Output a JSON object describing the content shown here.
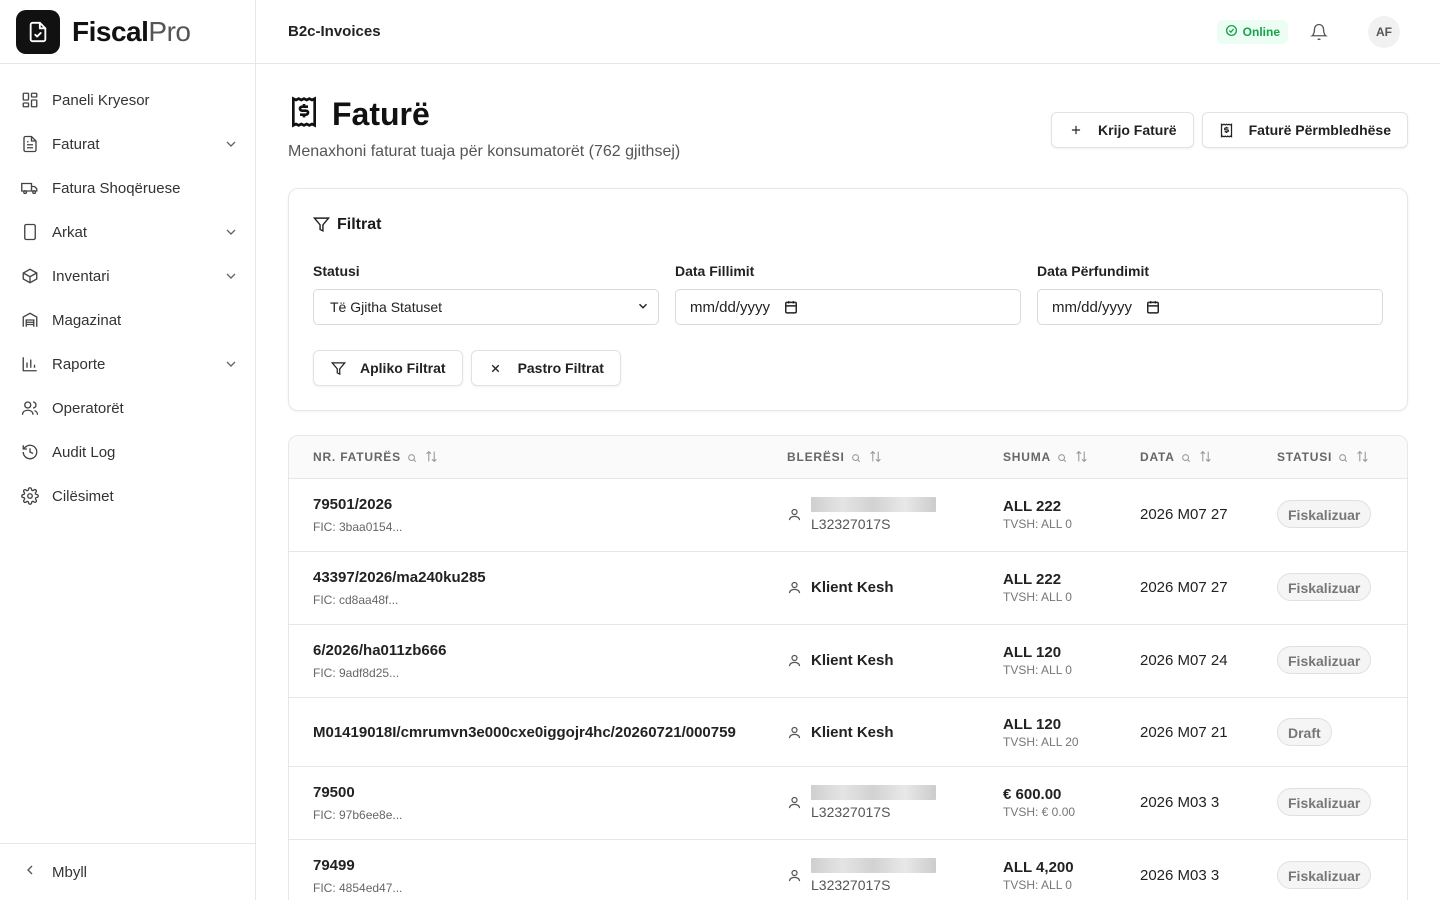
{
  "brand": {
    "name_bold": "Fiscal",
    "name_light": "Pro"
  },
  "sidebar": {
    "items": [
      {
        "label": "Paneli Kryesor",
        "icon": "dashboard-icon",
        "has_children": false
      },
      {
        "label": "Faturat",
        "icon": "invoice-icon",
        "has_children": true
      },
      {
        "label": "Fatura Shoqëruese",
        "icon": "truck-icon",
        "has_children": false
      },
      {
        "label": "Arkat",
        "icon": "tablet-icon",
        "has_children": true
      },
      {
        "label": "Inventari",
        "icon": "package-icon",
        "has_children": true
      },
      {
        "label": "Magazinat",
        "icon": "warehouse-icon",
        "has_children": false
      },
      {
        "label": "Raporte",
        "icon": "bar-chart-icon",
        "has_children": true
      },
      {
        "label": "Operatorët",
        "icon": "users-icon",
        "has_children": false
      },
      {
        "label": "Audit Log",
        "icon": "history-icon",
        "has_children": false
      },
      {
        "label": "Cilësimet",
        "icon": "gear-icon",
        "has_children": false
      }
    ],
    "collapse_label": "Mbyll"
  },
  "topbar": {
    "title": "B2c-Invoices",
    "status": "Online",
    "avatar": "AF"
  },
  "page": {
    "title": "Faturë",
    "subtitle": "Menaxhoni faturat tuaja për konsumatorët (762 gjithsej)",
    "create_label": "Krijo Faturë",
    "summary_label": "Faturë Përmbledhëse"
  },
  "filters": {
    "title": "Filtrat",
    "status_label": "Statusi",
    "status_value": "Të Gjitha Statuset",
    "start_label": "Data Fillimit",
    "start_placeholder": "mm/dd/yyyy",
    "end_label": "Data Përfundimit",
    "end_placeholder": "mm/dd/yyyy",
    "apply_label": "Apliko Filtrat",
    "clear_label": "Pastro Filtrat"
  },
  "table": {
    "columns": [
      "NR. FATURËS",
      "BLERËSI",
      "SHUMA",
      "DATA",
      "STATUSI"
    ],
    "rows": [
      {
        "nr": "79501/2026",
        "fic": "FIC: 3baa0154...",
        "buyer": "",
        "nipt": "L32327017S",
        "amount": "ALL 222",
        "vat": "TVSH: ALL 0",
        "date": "2026 M07 27",
        "status": "Fiskalizuar"
      },
      {
        "nr": "43397/2026/ma240ku285",
        "fic": "FIC: cd8aa48f...",
        "buyer": "Klient Kesh",
        "nipt": "",
        "amount": "ALL 222",
        "vat": "TVSH: ALL 0",
        "date": "2026 M07 27",
        "status": "Fiskalizuar"
      },
      {
        "nr": "6/2026/ha011zb666",
        "fic": "FIC: 9adf8d25...",
        "buyer": "Klient Kesh",
        "nipt": "",
        "amount": "ALL 120",
        "vat": "TVSH: ALL 0",
        "date": "2026 M07 24",
        "status": "Fiskalizuar"
      },
      {
        "nr": "M01419018I/cmrumvn3e000cxe0iggojr4hc/20260721/000759",
        "fic": "",
        "buyer": "Klient Kesh",
        "nipt": "",
        "amount": "ALL 120",
        "vat": "TVSH: ALL 20",
        "date": "2026 M07 21",
        "status": "Draft"
      },
      {
        "nr": "79500",
        "fic": "FIC: 97b6ee8e...",
        "buyer": "",
        "nipt": "L32327017S",
        "amount": "€ 600.00",
        "vat": "TVSH: € 0.00",
        "date": "2026 M03 3",
        "status": "Fiskalizuar"
      },
      {
        "nr": "79499",
        "fic": "FIC: 4854ed47...",
        "buyer": "",
        "nipt": "L32327017S",
        "amount": "ALL 4,200",
        "vat": "TVSH: ALL 0",
        "date": "2026 M03 3",
        "status": "Fiskalizuar"
      }
    ]
  }
}
